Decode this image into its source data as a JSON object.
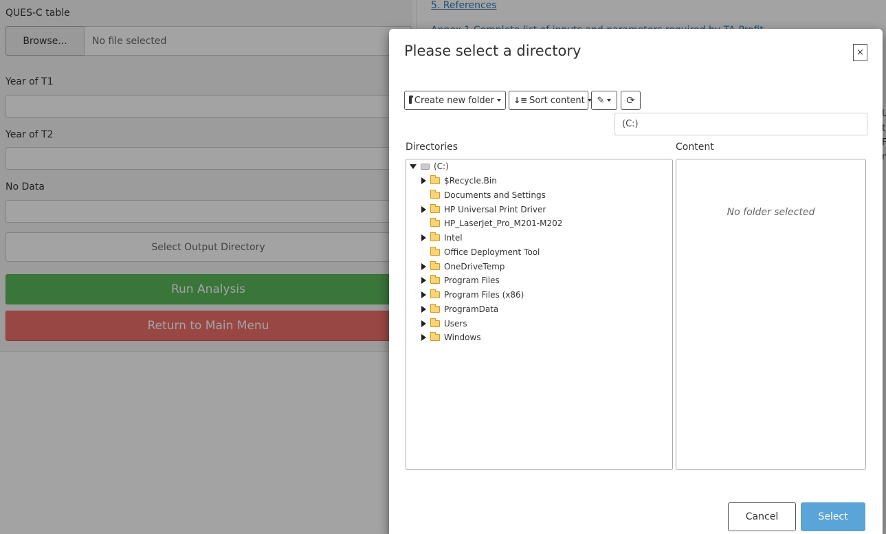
{
  "background": {
    "ques_label": "QUES-C table",
    "browse_label": "Browse...",
    "file_placeholder": "No file selected",
    "year_t1_label": "Year of T1",
    "year_t2_label": "Year of T2",
    "no_data_label": "No Data",
    "output_dir_label": "Select Output Directory",
    "run_label": "Run Analysis",
    "return_label": "Return to Main Menu",
    "references_link": "5. References",
    "annex_link": "Annex 1 Complete list of inputs and parameters required by TA-Profit",
    "edge_chars": [
      "U",
      "t",
      "F",
      "n"
    ]
  },
  "modal": {
    "title": "Please select a directory",
    "close_label": "×",
    "toolbar": {
      "create_folder_label": "Create new folder",
      "sort_label": "Sort content"
    },
    "path_value": "(C:)",
    "directories_label": "Directories",
    "content_label": "Content",
    "no_folder_text": "No folder selected",
    "tree": {
      "root": "(C:)",
      "children": [
        {
          "name": "$Recycle.Bin",
          "expandable": true
        },
        {
          "name": "Documents and Settings",
          "expandable": false
        },
        {
          "name": "HP Universal Print Driver",
          "expandable": true
        },
        {
          "name": "HP_LaserJet_Pro_M201-M202",
          "expandable": false
        },
        {
          "name": "Intel",
          "expandable": true
        },
        {
          "name": "Office Deployment Tool",
          "expandable": false
        },
        {
          "name": "OneDriveTemp",
          "expandable": true
        },
        {
          "name": "Program Files",
          "expandable": true
        },
        {
          "name": "Program Files (x86)",
          "expandable": true
        },
        {
          "name": "ProgramData",
          "expandable": true
        },
        {
          "name": "Users",
          "expandable": true
        },
        {
          "name": "Windows",
          "expandable": true
        }
      ]
    },
    "cancel_label": "Cancel",
    "select_label": "Select"
  }
}
